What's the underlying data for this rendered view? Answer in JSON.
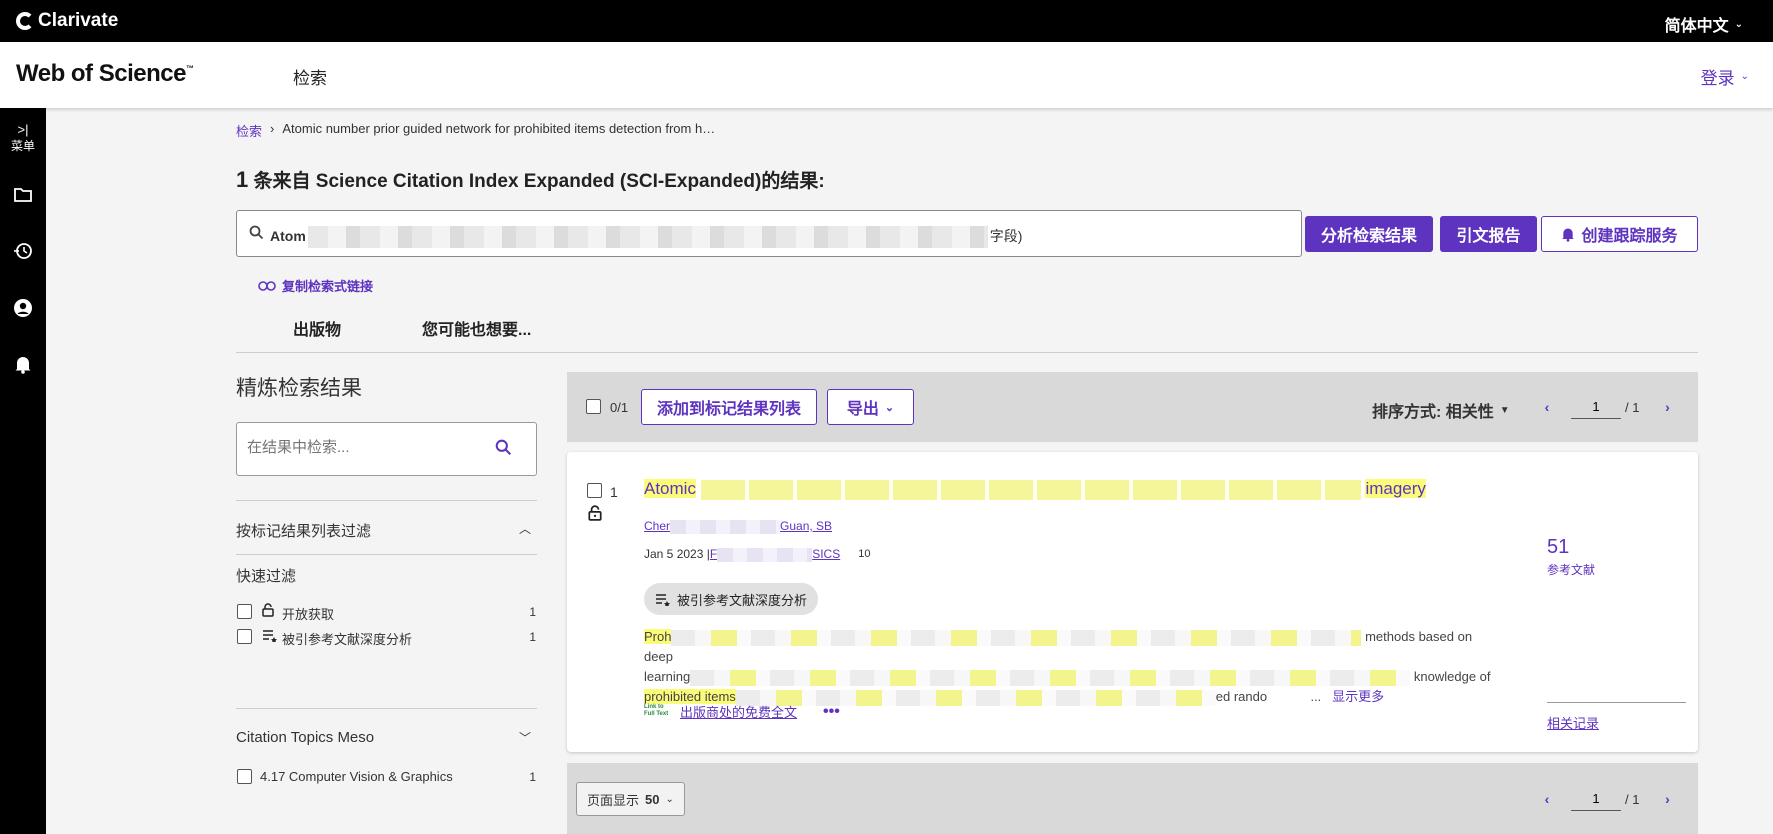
{
  "topbar": {
    "brand": "Clarivate",
    "language": "简体中文"
  },
  "header": {
    "logo": "Web of Science",
    "logo_tm": "™",
    "nav_search": "检索",
    "login": "登录"
  },
  "rail": {
    "menu_label": "菜单"
  },
  "breadcrumb": {
    "root": "检索",
    "current": "Atomic number prior guided network for prohibited items detection from h…"
  },
  "results_heading": {
    "count": "1",
    "text": " 条来自 Science Citation Index Expanded (SCI-Expanded)的结果:"
  },
  "query": {
    "prefix": "Atom",
    "suffix": "字段)"
  },
  "actions": {
    "analyze": "分析检索结果",
    "citation_report": "引文报告",
    "create_alert": "创建跟踪服务"
  },
  "copy_link": "复制检索式链接",
  "tabs": [
    "出版物",
    "您可能也想要..."
  ],
  "refine": {
    "title": "精炼检索结果",
    "search_placeholder": "在结果中检索...",
    "marked_filter": "按标记结果列表过滤",
    "quick_filter": "快速过滤",
    "quick_items": [
      {
        "label": "开放获取",
        "count": "1"
      },
      {
        "label": "被引参考文献深度分析",
        "count": "1"
      }
    ],
    "topics_title": "Citation Topics Meso",
    "topics": [
      {
        "label": "4.17 Computer Vision & Graphics",
        "count": "1"
      }
    ]
  },
  "toolbar": {
    "selected": "0/1",
    "add_to_marked": "添加到标记结果列表",
    "export": "导出",
    "sort": "排序方式: 相关性",
    "page": "1",
    "page_total": "/ 1"
  },
  "record": {
    "number": "1",
    "title_start": "Atomic",
    "title_end": "imagery",
    "authors_start": "Cher",
    "authors_end": "Guan, SB",
    "date": "Jan 5 2023 | ",
    "journal_start": "F",
    "journal_end": "SICS",
    "cited_count": "10",
    "chip": "被引参考文献深度分析",
    "abstract_l1_start": "Proh",
    "abstract_l1_end": "methods based on deep",
    "abstract_l2_start": "learning",
    "abstract_l2_end": "knowledge of",
    "abstract_l3_start": "prohibited items",
    "abstract_l3_end": "ed rando",
    "abstract_ellipsis": "...",
    "show_more": "显示更多",
    "fulltext_icon": "Link to Full Text",
    "fulltext": "出版商处的免费全文",
    "more_options": "•••",
    "references_count": "51",
    "references_label": "参考文献",
    "related": "相关记录"
  },
  "bottom": {
    "per_page_label": "页面显示",
    "per_page_value": "50",
    "page": "1",
    "page_total": "/ 1"
  },
  "colors": {
    "accent": "#5e33bf",
    "highlight": "#fbfb7a",
    "topbar": "#000000",
    "panel": "#d9d9d9"
  }
}
